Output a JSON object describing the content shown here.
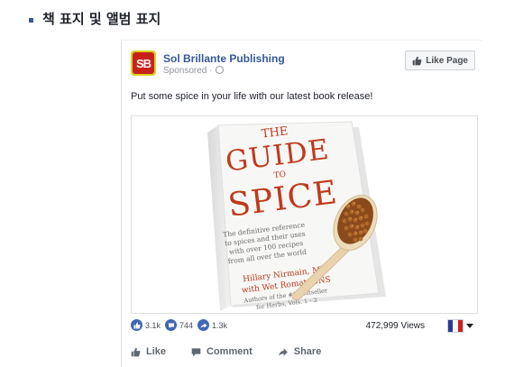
{
  "section": {
    "title": "책 표지 및 앨범 표지"
  },
  "post": {
    "page_name": "Sol Brillante Publishing",
    "logo_text": "SB",
    "sponsored": "Sponsored",
    "sponsored_sep": "·",
    "like_page_label": "Like Page",
    "text": "Put some spice in your life with our latest book release!",
    "book": {
      "title_the": "THE",
      "title_guide": "GUIDE",
      "title_to": "TO",
      "title_spice": "SPICE",
      "desc_lines": [
        "The definitive reference",
        "to spices and their uses",
        "with over 100 recipes",
        "from all over the world"
      ],
      "author_lines": [
        "Hillary Nirmain, MD",
        "with Wet Romat, CNS"
      ],
      "footer_lines": [
        "Authors of the #1 bestseller",
        "for Herbs, Vols. 1 - 3"
      ]
    },
    "reactions": {
      "likes": "3.1k",
      "comments": "744",
      "shares": "1.3k"
    },
    "views": "472,999 Views",
    "actions": {
      "like": "Like",
      "comment": "Comment",
      "share": "Share"
    }
  },
  "colors": {
    "brand_blue": "#365899",
    "reaction_blue": "#4267b2",
    "book_red": "#c0391b",
    "logo_red": "#c8211c",
    "logo_yellow": "#d8d020"
  },
  "icons": [
    "globe-icon",
    "thumbs-up-icon",
    "comment-icon",
    "share-icon",
    "flag-icon",
    "chevron-down-icon"
  ]
}
